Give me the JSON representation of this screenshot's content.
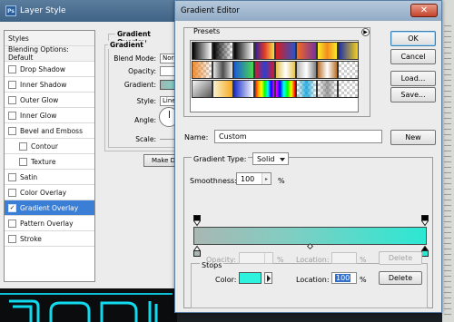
{
  "layer_style": {
    "title": "Layer Style",
    "styles_header": "Styles",
    "blending_options": "Blending Options: Default",
    "items": [
      {
        "label": "Drop Shadow",
        "checked": false,
        "sub": false
      },
      {
        "label": "Inner Shadow",
        "checked": false,
        "sub": false
      },
      {
        "label": "Outer Glow",
        "checked": false,
        "sub": false
      },
      {
        "label": "Inner Glow",
        "checked": false,
        "sub": false
      },
      {
        "label": "Bevel and Emboss",
        "checked": false,
        "sub": false
      },
      {
        "label": "Contour",
        "checked": false,
        "sub": true
      },
      {
        "label": "Texture",
        "checked": false,
        "sub": true
      },
      {
        "label": "Satin",
        "checked": false,
        "sub": false
      },
      {
        "label": "Color Overlay",
        "checked": false,
        "sub": false
      },
      {
        "label": "Gradient Overlay",
        "checked": true,
        "sub": false,
        "selected": true
      },
      {
        "label": "Pattern Overlay",
        "checked": false,
        "sub": false
      },
      {
        "label": "Stroke",
        "checked": false,
        "sub": false
      }
    ],
    "panel_title": "Gradient Overlay",
    "panel_subtitle": "Gradient",
    "blend_mode_label": "Blend Mode:",
    "blend_mode_value": "Norr",
    "opacity_label": "Opacity:",
    "gradient_label": "Gradient:",
    "style_label": "Style:",
    "style_value": "Line",
    "angle_label": "Angle:",
    "scale_label": "Scale:",
    "make_default_label": "Make D"
  },
  "gradient_editor": {
    "title": "Gradient Editor",
    "close_glyph": "✕",
    "presets_label": "Presets",
    "presets_menu_glyph": "▶",
    "buttons": {
      "ok": "OK",
      "cancel": "Cancel",
      "load": "Load...",
      "save": "Save...",
      "new": "New"
    },
    "name_label": "Name:",
    "name_value": "Custom",
    "gradient_type_label": "Gradient Type:",
    "gradient_type_value": "Solid",
    "smoothness_label": "Smoothness:",
    "smoothness_value": "100",
    "smoothness_unit": "%",
    "stops": {
      "label": "Stops",
      "opacity_label": "Opacity:",
      "opacity_unit": "%",
      "opacity_location_label": "Location:",
      "opacity_location_unit": "%",
      "opacity_delete": "Delete",
      "color_label": "Color:",
      "color_value": "#2ff2de",
      "color_location_label": "Location:",
      "color_location_value": "100",
      "color_location_unit": "%",
      "color_delete": "Delete"
    }
  },
  "colors": {
    "gradient_start": "#a9b7b2",
    "gradient_end": "#2be8d3",
    "selection": "#3a7fd5"
  }
}
